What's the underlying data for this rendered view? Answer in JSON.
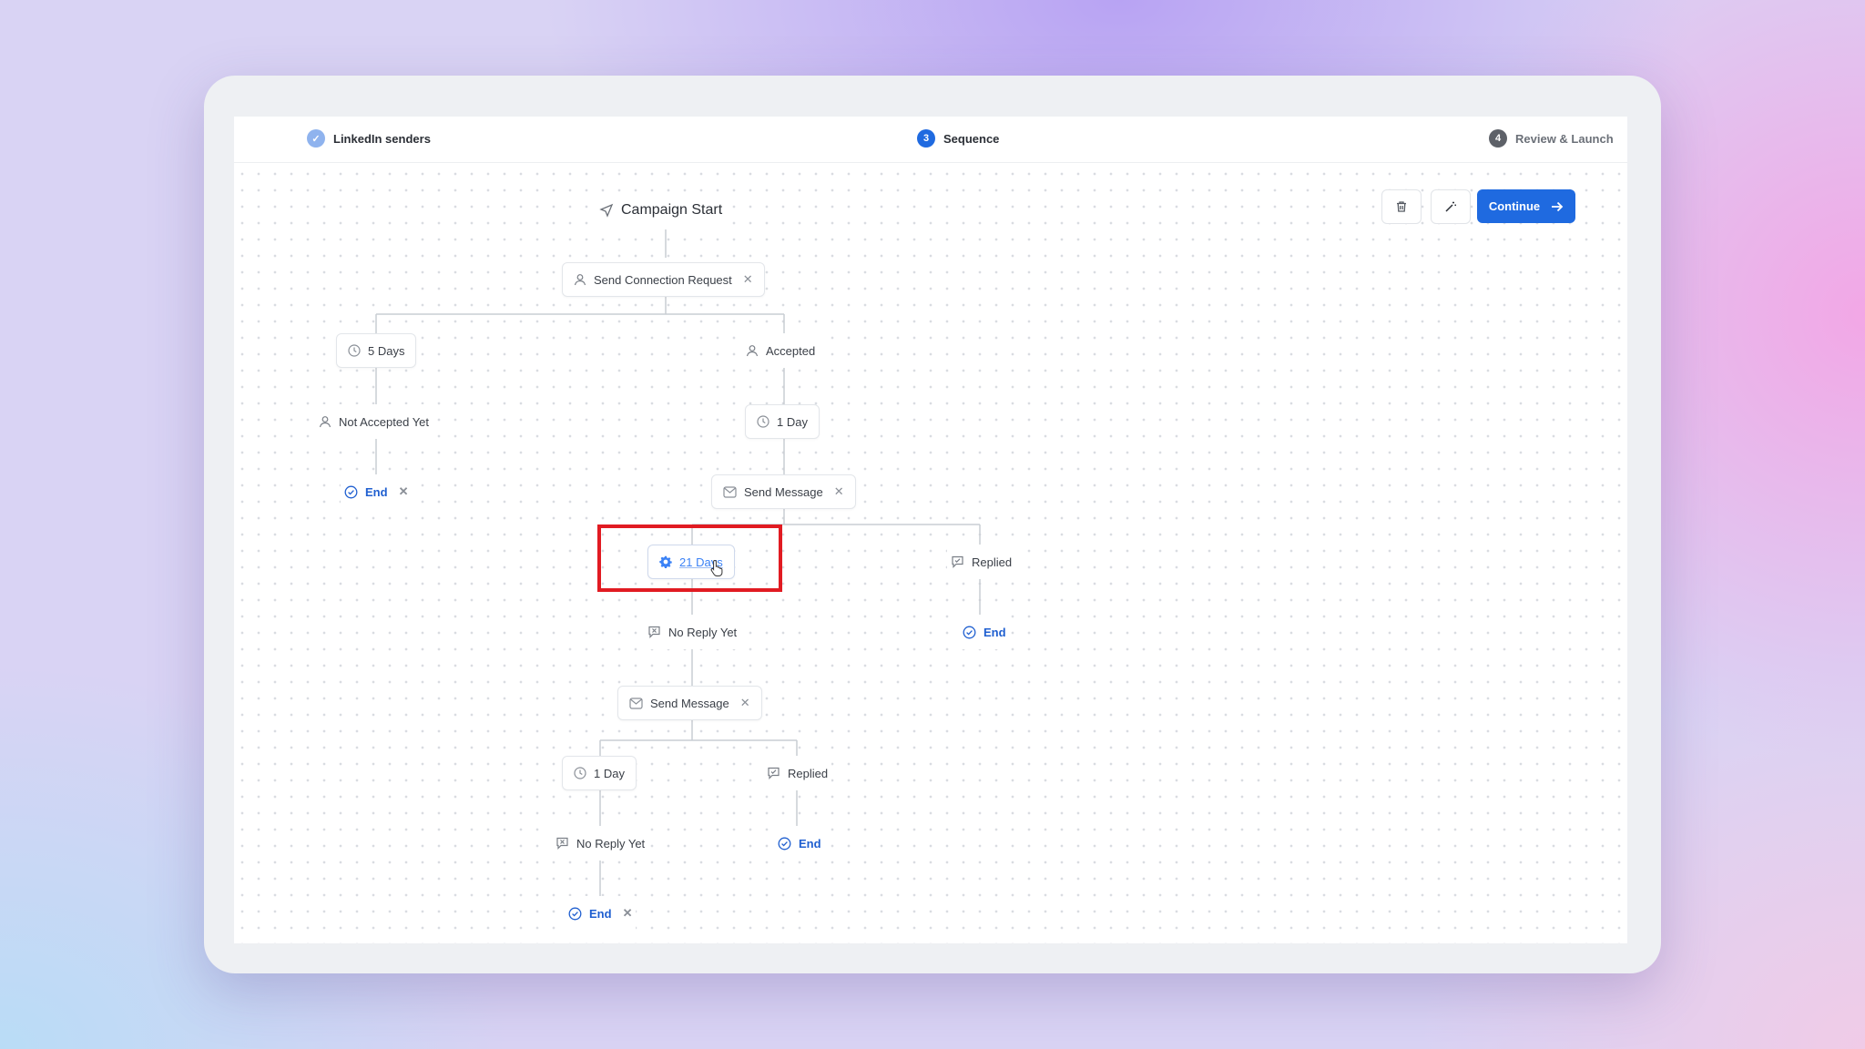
{
  "steps": [
    {
      "number": "✓",
      "label": "LinkedIn senders"
    },
    {
      "number": "3",
      "label": "Sequence"
    },
    {
      "number": "4",
      "label": "Review & Launch"
    }
  ],
  "toolbar": {
    "continue_label": "Continue"
  },
  "flow": {
    "start": "Campaign Start",
    "send_connection": "Send Connection Request",
    "wait_5_days": "5 Days",
    "accepted": "Accepted",
    "not_accepted": "Not Accepted Yet",
    "end_a": "End",
    "wait_1_day_a": "1 Day",
    "send_message_a": "Send Message",
    "wait_21_days": "21 Days",
    "replied_a": "Replied",
    "end_b": "End",
    "no_reply_a": "No Reply Yet",
    "send_message_b": "Send Message",
    "wait_1_day_b": "1 Day",
    "replied_b": "Replied",
    "no_reply_b": "No Reply Yet",
    "end_c": "End",
    "end_d": "End"
  },
  "colors": {
    "accent": "#1f6ae0",
    "highlight": "#e11b22"
  }
}
